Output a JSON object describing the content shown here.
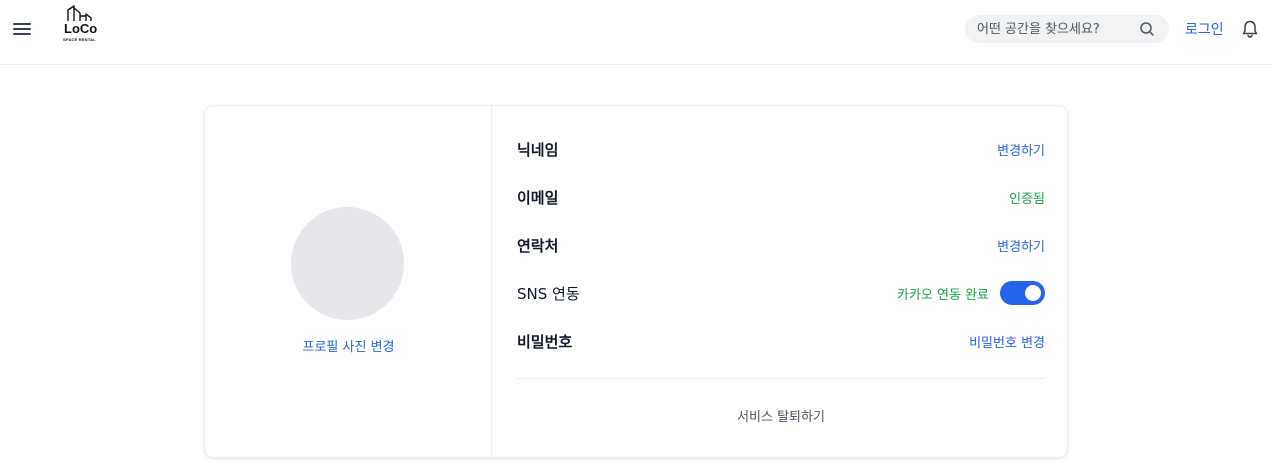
{
  "header": {
    "logo": {
      "name": "LoCo",
      "tagline": "SPACE RENTAL"
    },
    "search": {
      "placeholder": "어떤 공간을 찾으세요?",
      "value": ""
    },
    "login_label": "로그인",
    "icons": {
      "menu": "hamburger-menu-icon",
      "search": "search-icon",
      "notifications": "bell-icon"
    }
  },
  "profile": {
    "change_photo_label": "프로필 사진 변경"
  },
  "settings": {
    "nickname": {
      "label": "닉네임",
      "action": "변경하기"
    },
    "email": {
      "label": "이메일",
      "status": "인증됨"
    },
    "contact": {
      "label": "연락처",
      "action": "변경하기"
    },
    "sns": {
      "label": "SNS 연동",
      "status": "카카오 연동 완료",
      "enabled": true
    },
    "password": {
      "label": "비밀번호",
      "action": "비밀번호 변경"
    },
    "withdraw_label": "서비스 탈퇴하기"
  },
  "colors": {
    "link": "#2563eb",
    "success": "#16a34a",
    "toggle_on": "#2563eb",
    "avatar_placeholder": "#e5e7eb"
  }
}
